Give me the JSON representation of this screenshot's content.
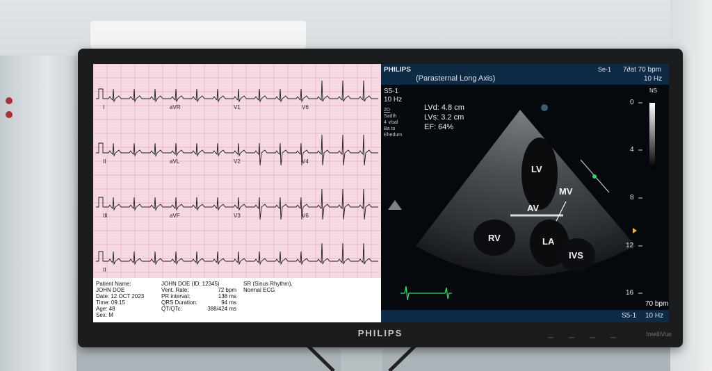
{
  "ecg": {
    "leads": [
      "I",
      "aVR",
      "V1",
      "V6",
      "II",
      "aVL",
      "V2",
      "V4",
      "III",
      "aVF",
      "V3",
      "V6",
      "II"
    ],
    "info": {
      "col1": [
        "Patient Name:",
        "JOHN DOE",
        "Date: 12 OCT 2023",
        "Time: 09:15",
        "Age: 48",
        "Sex: M"
      ],
      "col2_title": "JOHN DOE (ID: 12345)",
      "col2_labels": [
        "Vent. Rate:",
        "PR interval:",
        "QRS Duration:",
        "QT/QTc:"
      ],
      "col2_values": [
        "72 bpm",
        "138 ms",
        "94 ms",
        "388/424 ms"
      ],
      "col3": [
        "SR (Sinus Rhythm),",
        "Normal ECG"
      ]
    }
  },
  "echo": {
    "brand": "PHILIPS",
    "view": "(Parasternal Long Axis)",
    "header_mid": "Se-1",
    "header_rate": "7∂at 70 bpm",
    "header_hz": "10 Hz",
    "probe": "S5-1",
    "probe_hz": "10 Hz",
    "side_labels": [
      "2D",
      "Sadth",
      "4 ∨bal",
      "Ba to",
      "Ehedum"
    ],
    "measurements": [
      "LVd: 4.8 cm",
      "LVs: 3.2 cm",
      "EF: 64%"
    ],
    "scale_unit": "NS",
    "depth_ticks": [
      "0",
      "4",
      "8",
      "12",
      "16"
    ],
    "structures": [
      "LV",
      "MV",
      "AV",
      "RV",
      "LA",
      "IVS"
    ],
    "footer_rate": "70 bpm",
    "footer_probe": "S5-1",
    "footer_hz": "10 Hz",
    "colors": {
      "header": "#0e2a44",
      "trace": "#2bd66a",
      "ecg_bg": "#f7dde4"
    }
  },
  "monitor": {
    "brand": "PHILIPS",
    "model": "IntelliVue"
  }
}
